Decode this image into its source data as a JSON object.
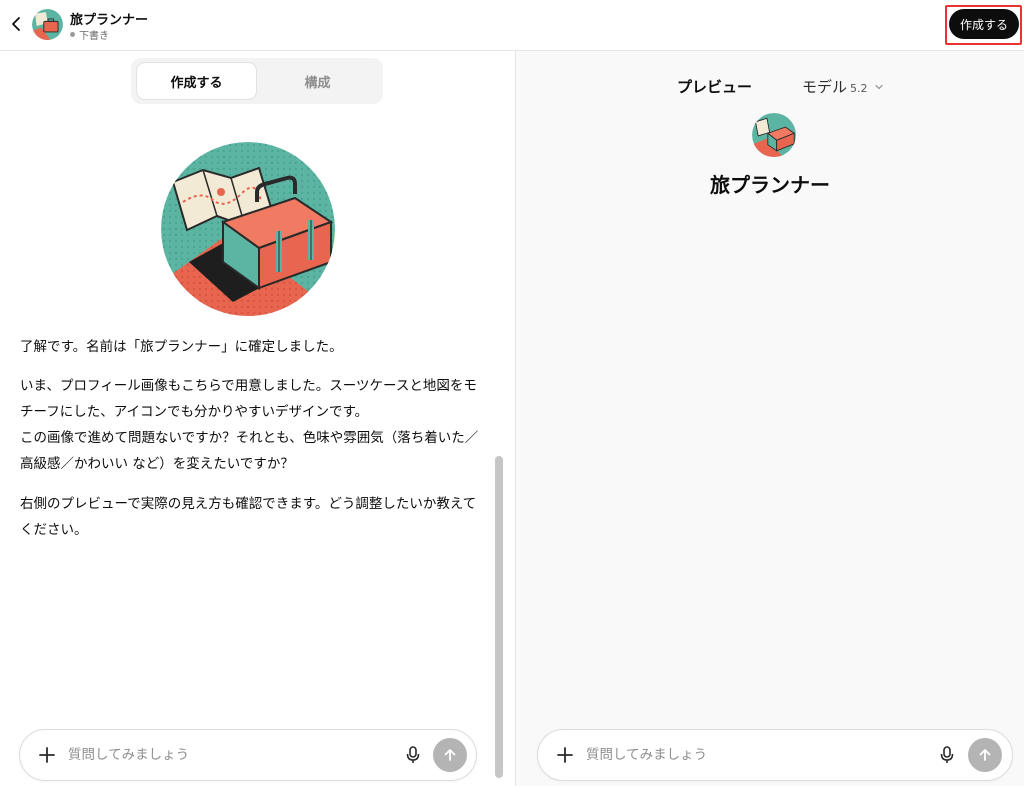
{
  "header": {
    "gpt_name": "旅プランナー",
    "status": "下書き",
    "create_button": "作成する"
  },
  "builder": {
    "tabs": [
      {
        "label": "作成する",
        "active": true
      },
      {
        "label": "構成",
        "active": false
      }
    ],
    "messages": [
      "了解です。名前は「旅プランナー」に確定しました。",
      "いま、プロフィール画像もこちらで用意しました。スーツケースと地図をモチーフにした、アイコンでも分かりやすいデザインです。\nこの画像で進めて問題ないですか？それとも、色味や雰囲気（落ち着いた／高級感／かわいい など）を変えたいですか？",
      "右側のプレビューで実際の見え方も確認できます。どう調整したいか教えてください。"
    ],
    "composer": {
      "placeholder": "質問してみましょう"
    }
  },
  "preview": {
    "label": "プレビュー",
    "model_label": "モデル",
    "model_version": "5.2",
    "gpt_name": "旅プランナー",
    "composer": {
      "placeholder": "質問してみましょう"
    }
  },
  "icons": {
    "back": "chevron-left-icon",
    "plus": "plus-icon",
    "mic": "microphone-icon",
    "send": "arrow-up-icon",
    "model_dropdown": "chevron-down-icon"
  },
  "colors": {
    "teal": "#5bb5a2",
    "coral": "#e8654f",
    "cream": "#f3ead6",
    "highlight": "#e8332f"
  }
}
